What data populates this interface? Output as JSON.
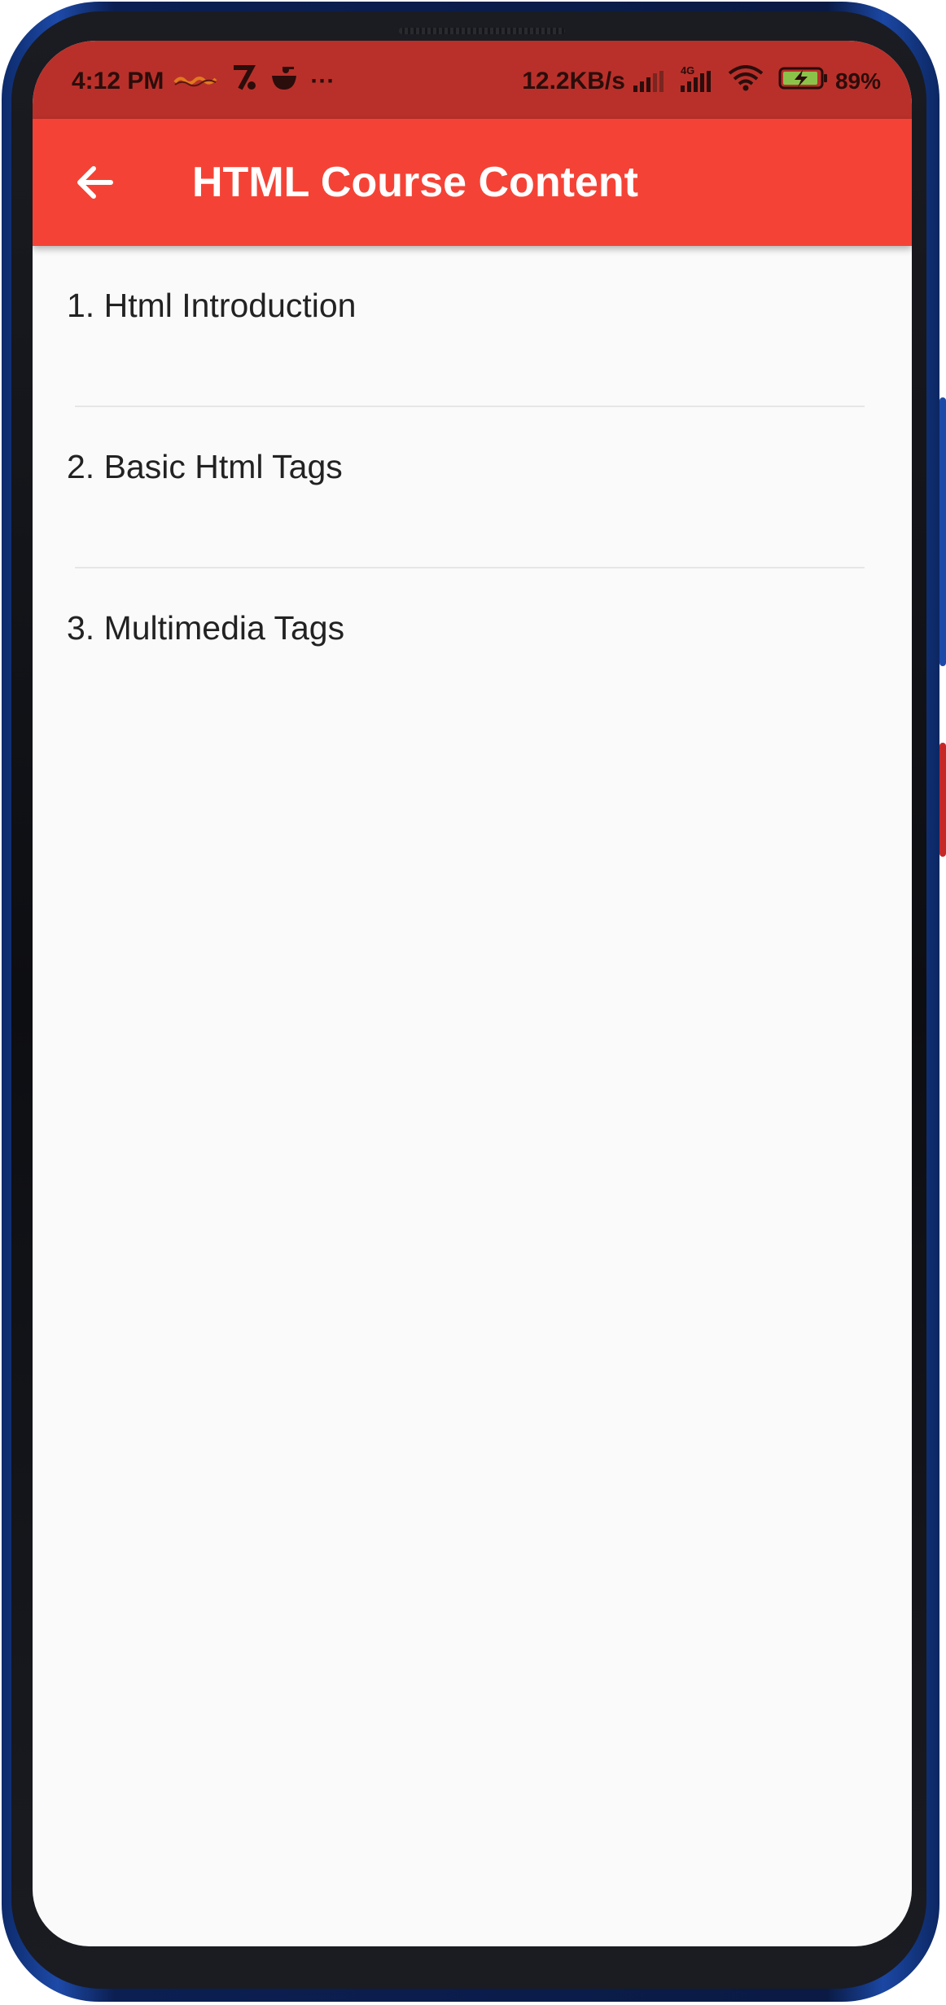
{
  "status_bar": {
    "time": "4:12 PM",
    "more": "···",
    "network_speed": "12.2KB/s",
    "network_type": "4G",
    "battery": "89%"
  },
  "app_bar": {
    "title": "HTML Course Content",
    "back_icon": "arrow-back-icon"
  },
  "course_items": [
    {
      "label": "1. Html Introduction"
    },
    {
      "label": "2. Basic Html Tags"
    },
    {
      "label": "3. Multimedia Tags"
    }
  ],
  "colors": {
    "app_bar": "#f44336",
    "status_bar": "#b9302a",
    "frame": "#1d4aa8",
    "background": "#fafafa"
  }
}
